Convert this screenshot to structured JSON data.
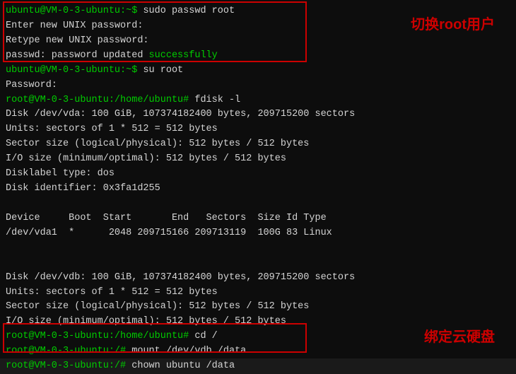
{
  "annotations": {
    "root_switch": "切换root用户",
    "bind_disk": "绑定云硬盘"
  },
  "terminal": {
    "lines": [
      {
        "prompt": "ubuntu@VM-0-3-ubuntu:~$",
        "cmd": " sudo passwd root"
      },
      {
        "output": "Enter new UNIX password:"
      },
      {
        "output": "Retype new UNIX password:"
      },
      {
        "output": "passwd: password updated successfully"
      },
      {
        "prompt": "ubuntu@VM-0-3-ubuntu:~$",
        "cmd": " su root"
      },
      {
        "output": "Password:"
      },
      {
        "prompt": "root@VM-0-3-ubuntu:/home/ubuntu#",
        "cmd": " fdisk -l"
      },
      {
        "output": "Disk /dev/vda: 100 GiB, 107374182400 bytes, 209715200 sectors"
      },
      {
        "output": "Units: sectors of 1 * 512 = 512 bytes"
      },
      {
        "output": "Sector size (logical/physical): 512 bytes / 512 bytes"
      },
      {
        "output": "I/O size (minimum/optimal): 512 bytes / 512 bytes"
      },
      {
        "output": "Disklabel type: dos"
      },
      {
        "output": "Disk identifier: 0x3fa1d255"
      },
      {
        "output": "Device     Boot  Start       End   Sectors  Size Id Type"
      },
      {
        "output": "/dev/vda1  *      2048 209715166 209713119  100G 83 Linux"
      },
      {
        "output": "Disk /dev/vdb: 100 GiB, 107374182400 bytes, 209715200 sectors"
      },
      {
        "output": "Units: sectors of 1 * 512 = 512 bytes"
      },
      {
        "output": "Sector size (logical/physical): 512 bytes / 512 bytes"
      },
      {
        "output": "I/O size (minimum/optimal): 512 bytes / 512 bytes"
      },
      {
        "prompt": "root@VM-0-3-ubuntu:/home/ubuntu#",
        "cmd": " cd /"
      },
      {
        "prompt": "root@VM-0-3-ubuntu:/#",
        "cmd": " mount /dev/vdb /data"
      },
      {
        "prompt": "root@VM-0-3-ubuntu:/#",
        "cmd": " chown ubuntu /data"
      }
    ]
  }
}
